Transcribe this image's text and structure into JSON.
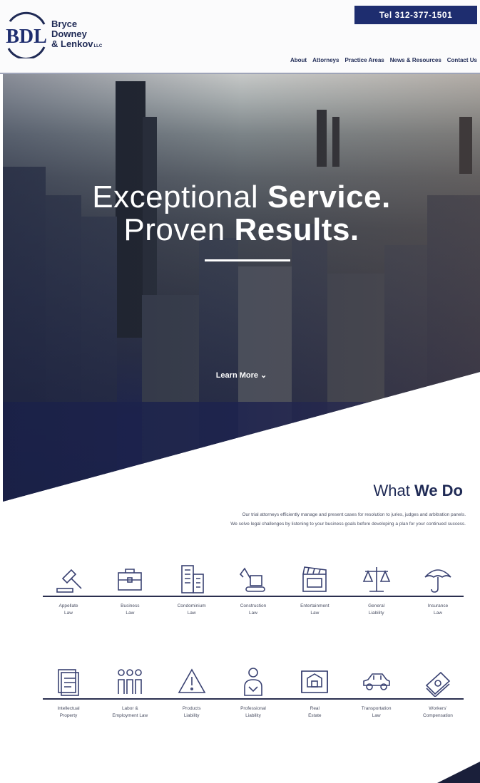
{
  "header": {
    "brand_lines": [
      "Bryce",
      "Downey",
      "& Lenkov"
    ],
    "brand_suffix": "LLC",
    "logo_letters": "BDL",
    "tel": "Tel 312-377-1501",
    "nav": [
      "About",
      "Attorneys",
      "Practice Areas",
      "News & Resources",
      "Contact Us"
    ]
  },
  "hero": {
    "line1_regular": "Exceptional ",
    "line1_bold": "Service.",
    "line2_regular": "Proven ",
    "line2_bold": "Results.",
    "cta": "Learn More ⌄"
  },
  "what_we_do": {
    "title_regular": "What ",
    "title_bold": "We Do",
    "description_line1": "Our trial attorneys efficiently manage and present cases for resolution to juries, judges and arbitration panels.",
    "description_line2": "We solve legal challenges by listening to your business goals before developing a plan for your continued success.",
    "row1": [
      {
        "icon": "gavel-icon",
        "label": "Appellate\nLaw"
      },
      {
        "icon": "briefcase-icon",
        "label": "Business\nLaw"
      },
      {
        "icon": "condominium-icon",
        "label": "Condominium\nLaw"
      },
      {
        "icon": "excavator-icon",
        "label": "Construction\nLaw"
      },
      {
        "icon": "clapperboard-icon",
        "label": "Entertainment\nLaw"
      },
      {
        "icon": "scales-icon",
        "label": "General\nLiability"
      },
      {
        "icon": "umbrella-icon",
        "label": "Insurance\nLaw"
      }
    ],
    "row2": [
      {
        "icon": "document-icon",
        "label": "Intellectual\nProperty"
      },
      {
        "icon": "workers-icon",
        "label": "Labor &\nEmployment Law"
      },
      {
        "icon": "warning-icon",
        "label": "Products\nLiability"
      },
      {
        "icon": "professional-icon",
        "label": "Professional\nLiability"
      },
      {
        "icon": "blueprint-icon",
        "label": "Real\nEstate"
      },
      {
        "icon": "car-icon",
        "label": "Transportation\nLaw"
      },
      {
        "icon": "money-icon",
        "label": "Workers'\nCompensation"
      }
    ]
  },
  "colors": {
    "navy": "#1e2d6f",
    "text": "#1f2a55"
  }
}
